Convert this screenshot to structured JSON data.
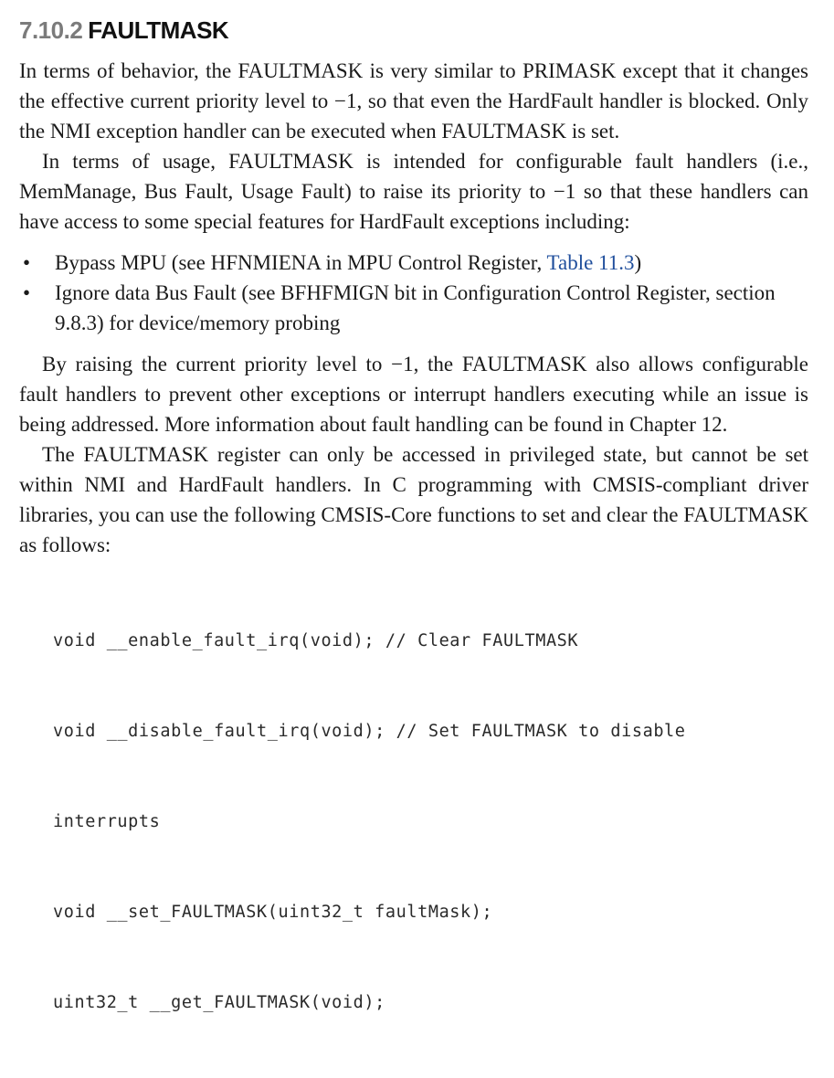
{
  "heading": {
    "number": "7.10.2",
    "title": "FAULTMASK"
  },
  "paragraphs": {
    "p1": "In terms of behavior, the FAULTMASK is very similar to PRIMASK except that it changes the effective current priority level to −1, so that even the HardFault handler is blocked. Only the NMI exception handler can be executed when FAULTMASK is set.",
    "p2": "In terms of usage, FAULTMASK is intended for configurable fault handlers (i.e., MemManage, Bus Fault, Usage Fault) to raise its priority to −1 so that these handlers can have access to some special features for HardFault exceptions including:",
    "p3": "By raising the current priority level to −1, the FAULTMASK also allows configurable fault handlers to prevent other exceptions or interrupt handlers executing while an issue is being addressed. More information about fault handling can be found in Chapter 12.",
    "p4": "The FAULTMASK register can only be accessed in privileged state, but cannot be set within NMI and HardFault handlers. In C programming with CMSIS-compliant driver libraries, you can use the following CMSIS-Core functions to set and clear the FAULTMASK as follows:"
  },
  "bullets": {
    "symbol": "•",
    "b1_text": "Bypass MPU (see HFNMIENA in MPU Control Register, ",
    "b1_link": "Table 11.3",
    "b1_end": ")",
    "b2_text": "Ignore data Bus Fault (see BFHFMIGN bit in Configuration Control Register, section 9.8.3) for device/memory probing"
  },
  "code": {
    "line1": "void __enable_fault_irq(void); // Clear FAULTMASK",
    "line2": "void __disable_fault_irq(void); // Set FAULTMASK to disable",
    "line3": "interrupts",
    "line4": "void __set_FAULTMASK(uint32_t faultMask);",
    "line5": "uint32_t __get_FAULTMASK(void);"
  },
  "colors": {
    "heading_number": "#7b7b7b",
    "link": "#1f4e9c",
    "text": "#1a1a1a"
  }
}
